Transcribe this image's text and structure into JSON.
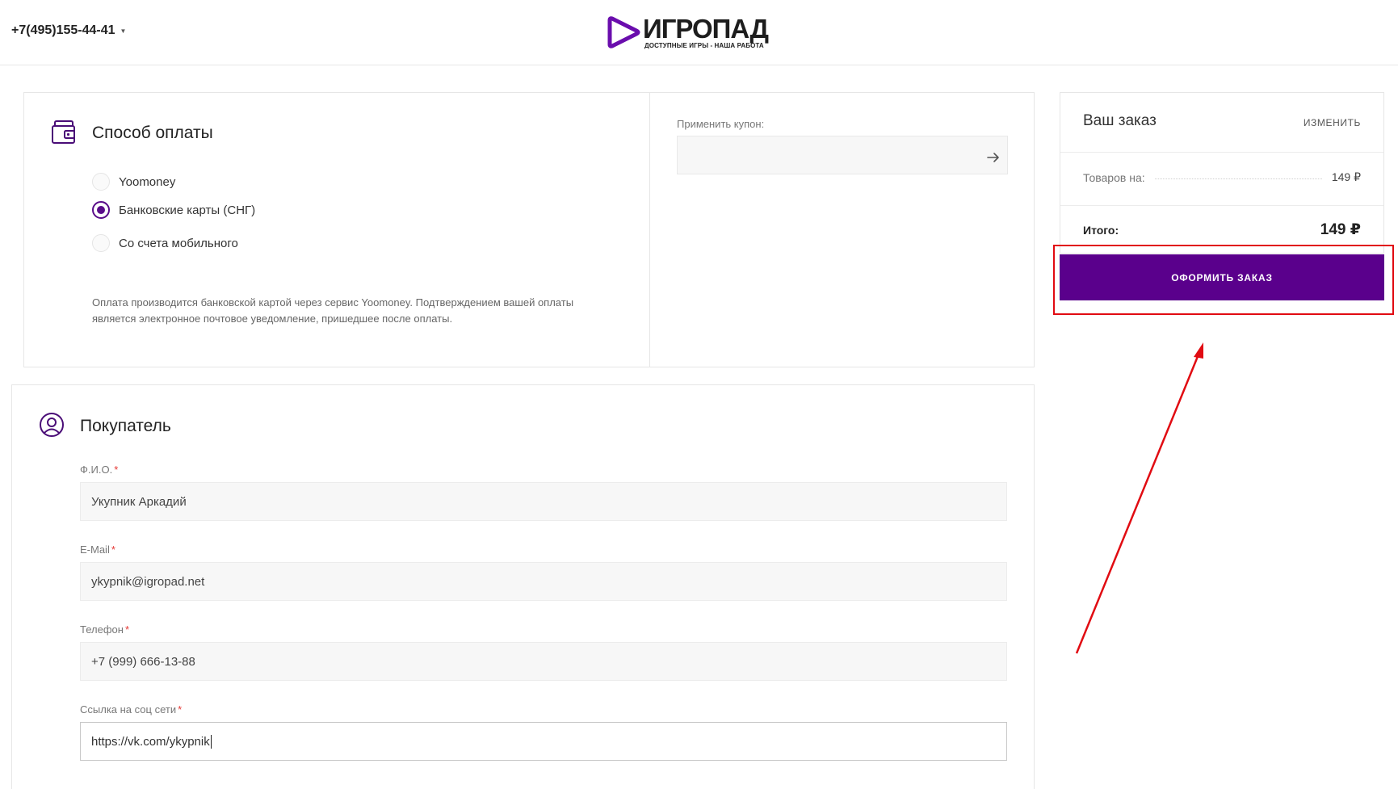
{
  "header": {
    "phone": "+7(495)155-44-41",
    "logo_title": "ИГРОПАД",
    "logo_subtitle": "ДОСТУПНЫЕ ИГРЫ - НАША РАБОТА"
  },
  "payment": {
    "title": "Способ оплаты",
    "options": [
      {
        "label": "Yoomoney",
        "selected": false
      },
      {
        "label": "Банковские карты (СНГ)",
        "selected": true
      },
      {
        "label": "Со счета мобильного",
        "selected": false
      }
    ],
    "note": "Оплата производится банковской картой через сервис Yoomoney. Подтверждением вашей оплаты является электронное почтовое уведомление, пришедшее после оплаты.",
    "coupon_label": "Применить купон:",
    "coupon_value": ""
  },
  "buyer": {
    "title": "Покупатель",
    "fields": [
      {
        "label": "Ф.И.О.",
        "required": "*",
        "value": "Укупник Аркадий"
      },
      {
        "label": "E-Mail",
        "required": "*",
        "value": "ykypnik@igropad.net"
      },
      {
        "label": "Телефон",
        "required": "*",
        "value": "+7 (999) 666-13-88"
      },
      {
        "label": "Ссылка на соц сети",
        "required": "*",
        "value": "https://vk.com/ykypnik"
      }
    ]
  },
  "order": {
    "title": "Ваш заказ",
    "change_label": "изменить",
    "items_label": "Товаров на:",
    "items_amount": "149 ₽",
    "total_label": "Итого:",
    "total_amount": "149 ₽",
    "checkout_label": "Оформить заказ"
  },
  "colors": {
    "accent": "#5a008c",
    "highlight": "#e10b12"
  }
}
